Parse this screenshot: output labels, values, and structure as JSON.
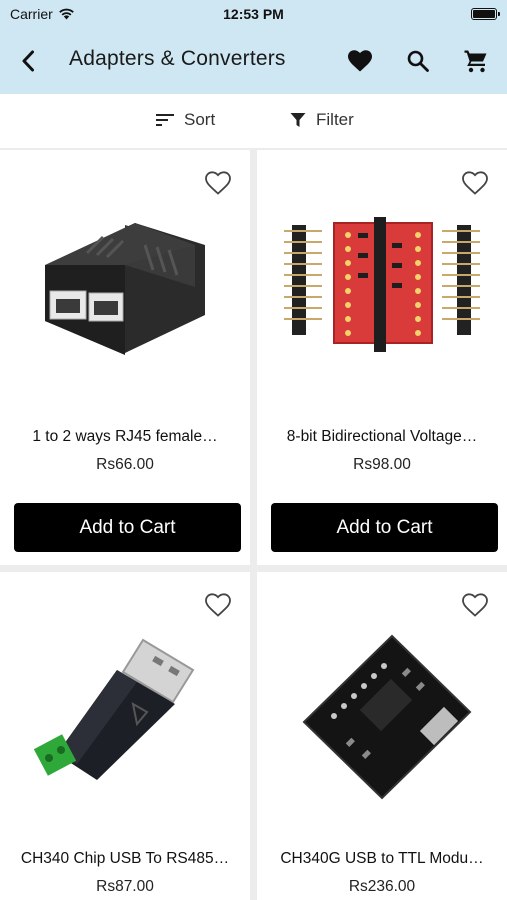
{
  "status_bar": {
    "carrier": "Carrier",
    "time": "12:53 PM"
  },
  "header": {
    "title": "Adapters & Converters"
  },
  "toolbar": {
    "sort_label": "Sort",
    "filter_label": "Filter"
  },
  "products": [
    {
      "name": "1 to 2 ways RJ45 female…",
      "price": "Rs66.00",
      "button": "Add to Cart",
      "image": "rj45-splitter"
    },
    {
      "name": "8-bit Bidirectional Voltage…",
      "price": "Rs98.00",
      "button": "Add to Cart",
      "image": "level-shifter-board"
    },
    {
      "name": "CH340 Chip USB To RS485…",
      "price": "Rs87.00",
      "image": "usb-rs485-dongle"
    },
    {
      "name": "CH340G USB to TTL Modu…",
      "price": "Rs236.00",
      "image": "usb-ttl-module"
    }
  ],
  "colors": {
    "header_bg": "#cfe7f2",
    "button_bg": "#000000",
    "page_bg": "#ececec"
  }
}
